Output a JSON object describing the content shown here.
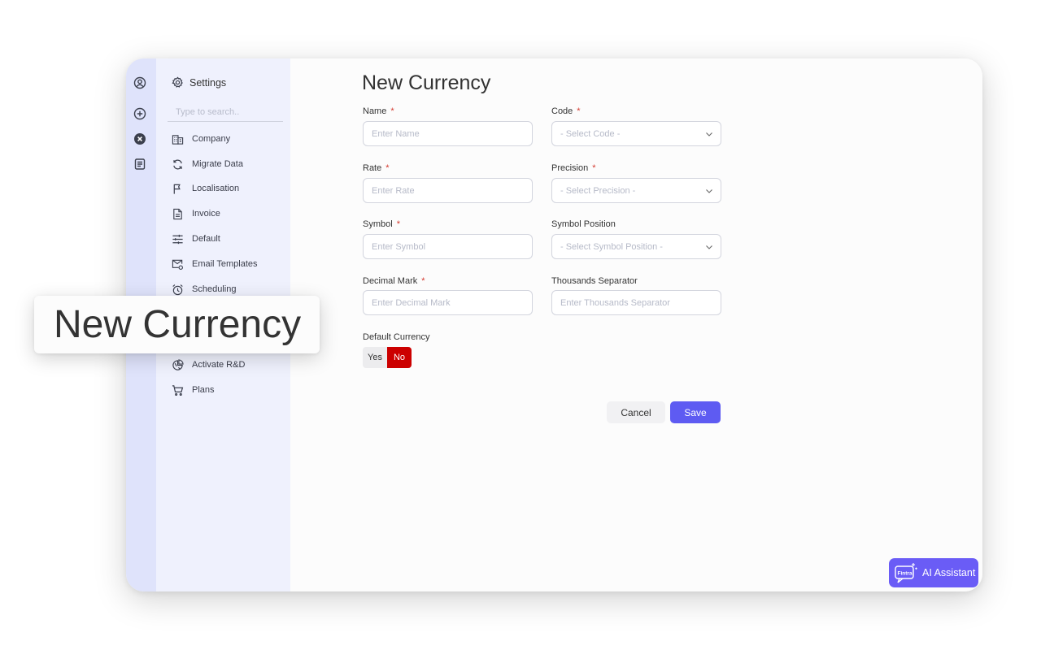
{
  "sidebar": {
    "title": "Settings",
    "search_placeholder": "Type to search..",
    "items": [
      {
        "label": "Company",
        "icon": "building-icon"
      },
      {
        "label": "Migrate Data",
        "icon": "sync-icon"
      },
      {
        "label": "Localisation",
        "icon": "flag-icon"
      },
      {
        "label": "Invoice",
        "icon": "document-icon"
      },
      {
        "label": "Default",
        "icon": "sliders-icon"
      },
      {
        "label": "Email Templates",
        "icon": "mail-settings-icon"
      },
      {
        "label": "Scheduling",
        "icon": "alarm-clock-icon"
      },
      {
        "label": "Activate R&D",
        "icon": "pie-chart-icon"
      },
      {
        "label": "Plans",
        "icon": "cart-icon"
      }
    ]
  },
  "form": {
    "title": "New Currency",
    "name": {
      "label": "Name",
      "required": "*",
      "placeholder": "Enter Name"
    },
    "code": {
      "label": "Code",
      "required": "*",
      "placeholder": "- Select Code -"
    },
    "rate": {
      "label": "Rate",
      "required": "*",
      "placeholder": "Enter Rate"
    },
    "precision": {
      "label": "Precision",
      "required": "*",
      "placeholder": "- Select Precision -"
    },
    "symbol": {
      "label": "Symbol",
      "required": "*",
      "placeholder": "Enter Symbol"
    },
    "symbol_position": {
      "label": "Symbol Position",
      "placeholder": "- Select Symbol Position -"
    },
    "decimal_mark": {
      "label": "Decimal Mark",
      "required": "*",
      "placeholder": "Enter Decimal Mark"
    },
    "thousands_separator": {
      "label": "Thousands Separator",
      "placeholder": "Enter Thousands Separator"
    },
    "default_currency": {
      "label": "Default Currency",
      "yes": "Yes",
      "no": "No",
      "selected": "No"
    },
    "cancel_label": "Cancel",
    "save_label": "Save"
  },
  "assistant": {
    "label": "AI Assistant",
    "logo_text": "Fintra"
  },
  "zoom_callout": {
    "text": "New Currency"
  },
  "colors": {
    "accent": "#5e5bf2",
    "toggle_no": "#cc0000",
    "required": "#d43a2f",
    "rail": "#dfe3fb",
    "sidebar": "#eff1fd"
  }
}
